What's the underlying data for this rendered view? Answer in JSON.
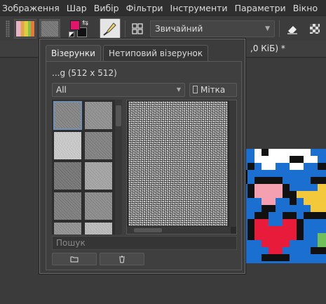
{
  "menubar": {
    "items": [
      "Зображення",
      "Шар",
      "Вибір",
      "Фільтри",
      "Інструменти",
      "Параметри",
      "Вікно"
    ]
  },
  "toolbar": {
    "blend_mode": "Звичайний",
    "fg_color": "#e0156b",
    "bg_color": "#111111",
    "icons": {
      "gradient": "gradient-icon",
      "pattern": "pattern-icon",
      "swap": "swap-colors-icon",
      "brush": "brush-icon",
      "presets": "presets-grid-icon",
      "eraser": "eraser-icon",
      "alpha": "alpha-lock-icon"
    }
  },
  "document": {
    "tab_title": ",0 КіБ) *"
  },
  "pattern_popup": {
    "tabs": [
      "Візерунки",
      "Нетиповий візерунок"
    ],
    "active_tab": 0,
    "pattern_name": "...g (512 x 512)",
    "filter": "All",
    "tag_button": "Мітка",
    "search_placeholder": "Пошук",
    "thumbnails": [
      {
        "tone": "#8d8d8d",
        "selected": true
      },
      {
        "tone": "#9a9a9a",
        "selected": false
      },
      {
        "tone": "#d8d8d8",
        "selected": false
      },
      {
        "tone": "#8a8a8a",
        "selected": false
      },
      {
        "tone": "#7d7d7d",
        "selected": false
      },
      {
        "tone": "#b0b0b0",
        "selected": false
      },
      {
        "tone": "#868686",
        "selected": false
      },
      {
        "tone": "#959595",
        "selected": false
      },
      {
        "tone": "#9c9c9c",
        "selected": false
      },
      {
        "tone": "#c8c8c8",
        "selected": false
      }
    ],
    "icons": {
      "open": "folder-icon",
      "delete": "trash-icon"
    }
  }
}
